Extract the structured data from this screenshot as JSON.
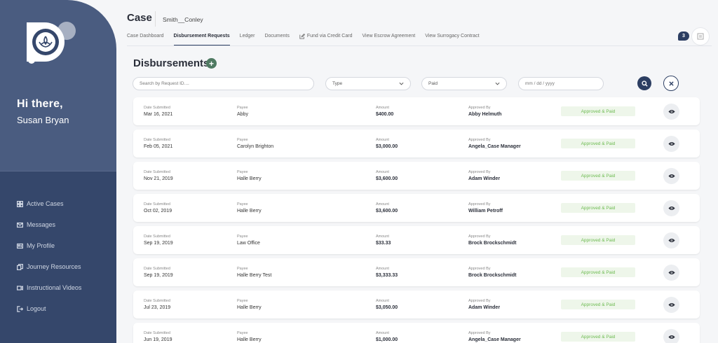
{
  "sidebar": {
    "greeting": "Hi there,",
    "user_name": "Susan Bryan",
    "nav": [
      {
        "label": "Active Cases",
        "icon": "grid-icon"
      },
      {
        "label": "Messages",
        "icon": "envelope-icon"
      },
      {
        "label": "My Profile",
        "icon": "id-card-icon"
      },
      {
        "label": "Journey Resources",
        "icon": "copy-icon"
      },
      {
        "label": "Instructional Videos",
        "icon": "video-icon"
      },
      {
        "label": "Logout",
        "icon": "logout-icon"
      }
    ]
  },
  "header": {
    "title": "Case",
    "case_name": "Smith__Conley",
    "tabs": [
      {
        "label": "Case Dashboard"
      },
      {
        "label": "Disbursement Requests",
        "active": true
      },
      {
        "label": "Ledger"
      },
      {
        "label": "Documents"
      },
      {
        "label": "Fund via Credit Card",
        "icon": "edit-icon"
      },
      {
        "label": "View Escrow Agreement"
      },
      {
        "label": "View Surrogacy Contract"
      }
    ],
    "notification_count": "3"
  },
  "section": {
    "title": "Disbursements",
    "add_symbol": "+"
  },
  "filters": {
    "search_placeholder": "Search by Request ID....",
    "type_value": "Type",
    "status_value": "Paid",
    "date_placeholder": "mm / dd / yyyy"
  },
  "columns": {
    "date": "Date Submitted",
    "payee": "Payee",
    "amount": "Amount",
    "approver": "Approved By"
  },
  "rows": [
    {
      "date": "Mar 16, 2021",
      "payee": "Abby",
      "amount": "$400.00",
      "approver": "Abby Helmuth",
      "status": "Approved & Paid"
    },
    {
      "date": "Feb 05, 2021",
      "payee": "Carolyn Brighton",
      "amount": "$3,000.00",
      "approver": "Angela_Case Manager",
      "status": "Approved & Paid"
    },
    {
      "date": "Nov 21, 2019",
      "payee": "Halle Berry",
      "amount": "$3,600.00",
      "approver": "Adam Winder",
      "status": "Approved & Paid"
    },
    {
      "date": "Oct 02, 2019",
      "payee": "Halle Berry",
      "amount": "$3,600.00",
      "approver": "William Petroff",
      "status": "Approved & Paid"
    },
    {
      "date": "Sep 19, 2019",
      "payee": "Law Office",
      "amount": "$33.33",
      "approver": "Brock Brockschmidt",
      "status": "Approved & Paid"
    },
    {
      "date": "Sep 19, 2019",
      "payee": "Halle Berry Test",
      "amount": "$3,333.33",
      "approver": "Brock Brockschmidt",
      "status": "Approved & Paid"
    },
    {
      "date": "Jul 23, 2019",
      "payee": "Halle Berry",
      "amount": "$3,050.00",
      "approver": "Adam Winder",
      "status": "Approved & Paid"
    },
    {
      "date": "Jun 19, 2019",
      "payee": "Halle Berry",
      "amount": "$1,000.00",
      "approver": "Angela_Case Manager",
      "status": "Approved & Paid"
    }
  ],
  "colors": {
    "sidebar_top": "#4a5c80",
    "sidebar_bottom": "#35476b",
    "primary": "#2c3e62",
    "accent_green": "#4f7a62",
    "status_green": "#6dbb51"
  }
}
